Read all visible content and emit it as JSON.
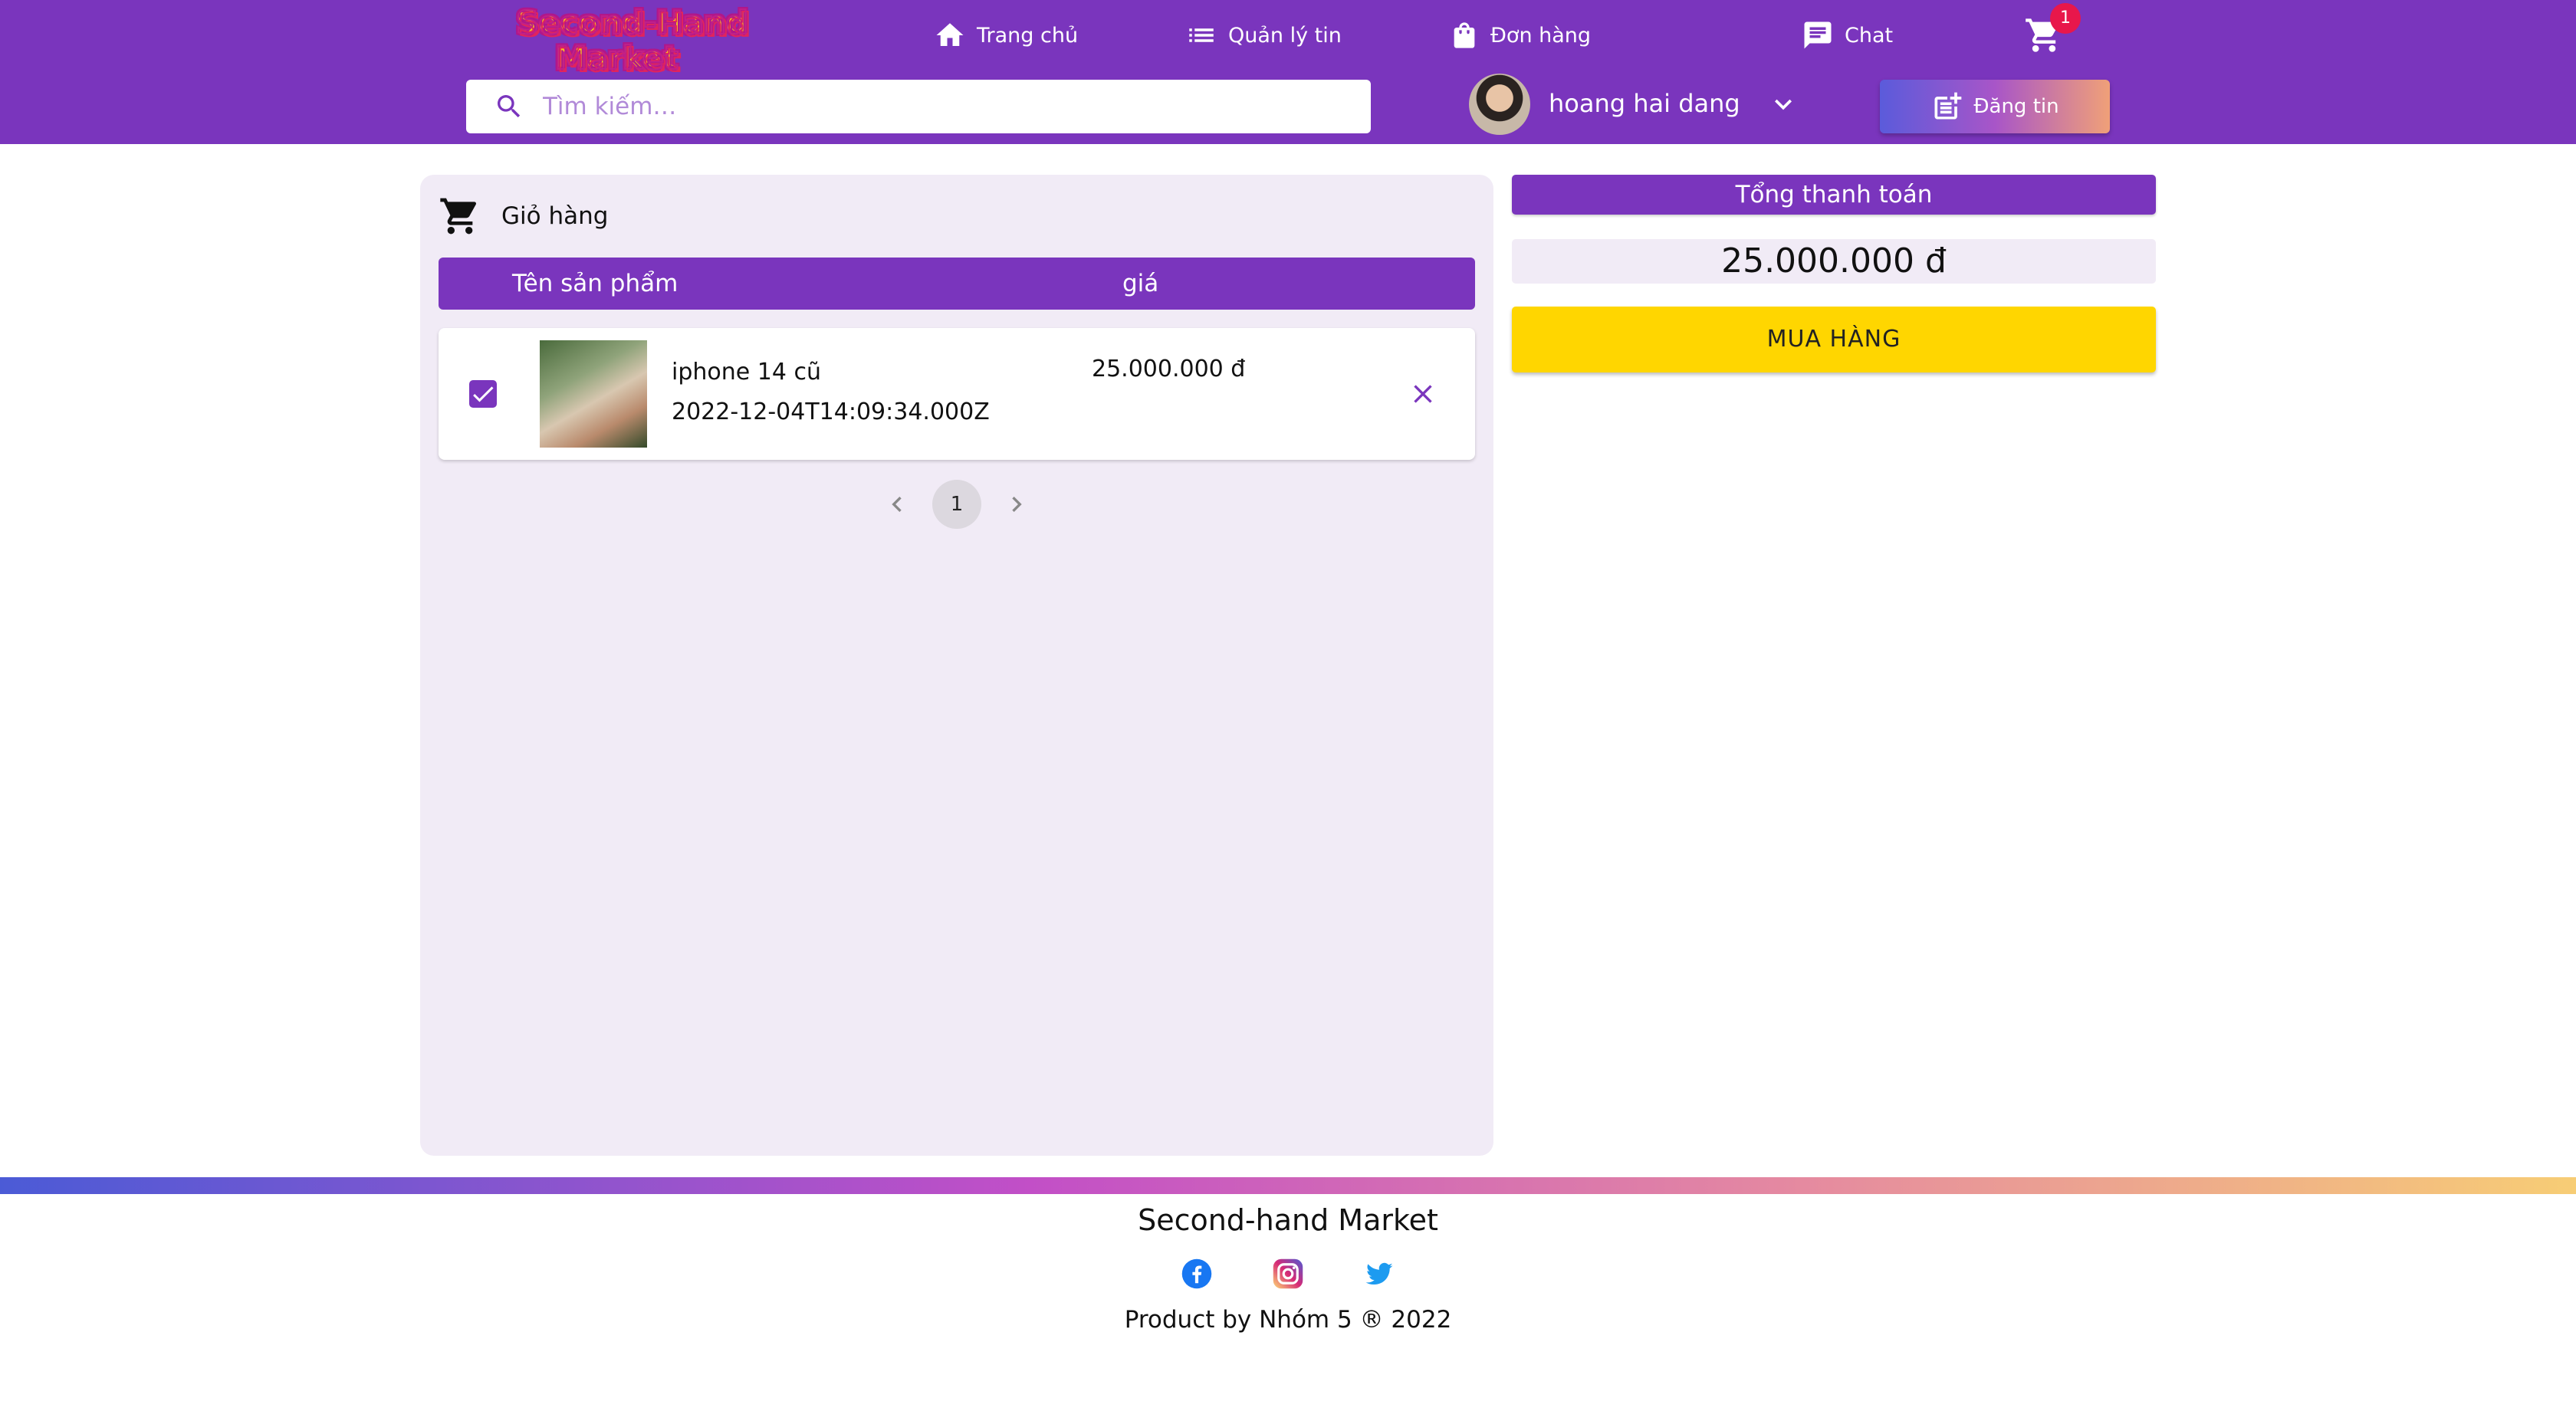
{
  "header": {
    "logo_text": "Second-Hand Market",
    "nav": [
      {
        "label": "Trang chủ",
        "icon": "home-icon"
      },
      {
        "label": "Quản lý tin",
        "icon": "list-icon"
      },
      {
        "label": "Đơn hàng",
        "icon": "shopping-bag-icon"
      },
      {
        "label": "Chat",
        "icon": "chat-icon"
      }
    ],
    "cart_count": "1",
    "search_placeholder": "Tìm kiếm…",
    "username": "hoang hai dang",
    "post_button_label": "Đăng tin"
  },
  "cart": {
    "title": "Giỏ hàng",
    "columns": [
      "Tên sản phẩm",
      "giá"
    ],
    "items": [
      {
        "name": "iphone 14 cũ",
        "date": "2022-12-04T14:09:34.000Z",
        "price": "25.000.000 đ",
        "checked": true
      }
    ],
    "pagination": {
      "current_page": "1"
    }
  },
  "summary": {
    "title": "Tổng thanh toán",
    "total": "25.000.000 đ",
    "buy_label": "MUA HÀNG"
  },
  "footer": {
    "title": "Second-hand Market",
    "socials": [
      "facebook-icon",
      "instagram-icon",
      "twitter-icon"
    ],
    "copyright": "Product by Nhóm 5 ® 2022"
  },
  "colors": {
    "primary": "#7a35bd",
    "buy_button": "#ffd600",
    "panel_bg": "#f1ebf6",
    "badge": "#e8174b"
  }
}
